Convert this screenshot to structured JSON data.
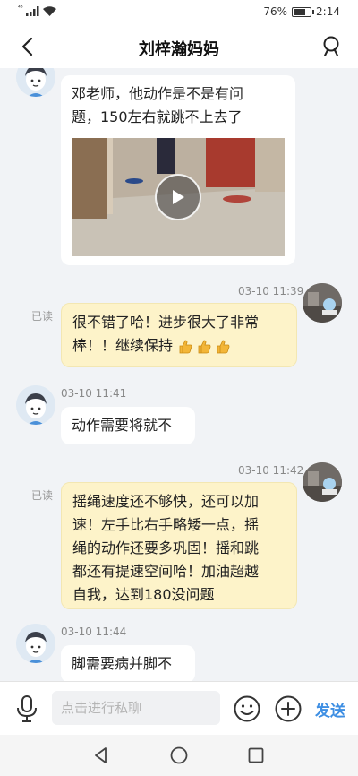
{
  "status": {
    "network": "⁴⁶",
    "battery": "76%",
    "battery_level": 0.76,
    "time": "2:14"
  },
  "header": {
    "title": "刘梓瀚妈妈"
  },
  "messages": [
    {
      "side": "left",
      "text": "邓老师，他动作是不是有问题，150左右就跳不上去了",
      "line1": "邓老师，他动作是不是有问",
      "line2": "题，150左右就跳不上去了",
      "attachment": "video"
    },
    {
      "side": "right",
      "time": "03-10 11:39",
      "read": "已读",
      "line1": "很不错了哈！进步很大了非常",
      "line2": "棒！！继续保持",
      "emoji": "thumbs-up ×3"
    },
    {
      "side": "left",
      "time": "03-10 11:41",
      "text": "动作需要将就不"
    },
    {
      "side": "right",
      "time": "03-10 11:42",
      "read": "已读",
      "lines": [
        "摇绳速度还不够快，还可以加",
        "速！左手比右手略矮一点，摇",
        "绳的动作还要多巩固！摇和跳",
        "都还有提速空间哈！加油超越",
        "自我，达到180没问题"
      ]
    },
    {
      "side": "left",
      "time": "03-10 11:44",
      "text": "脚需要病并脚不"
    }
  ],
  "input": {
    "placeholder": "点击进行私聊",
    "send_label": "发送"
  },
  "colors": {
    "accent": "#3f8fe3",
    "bubble_mine": "#fdf3c9",
    "background": "#f1f3f6"
  }
}
